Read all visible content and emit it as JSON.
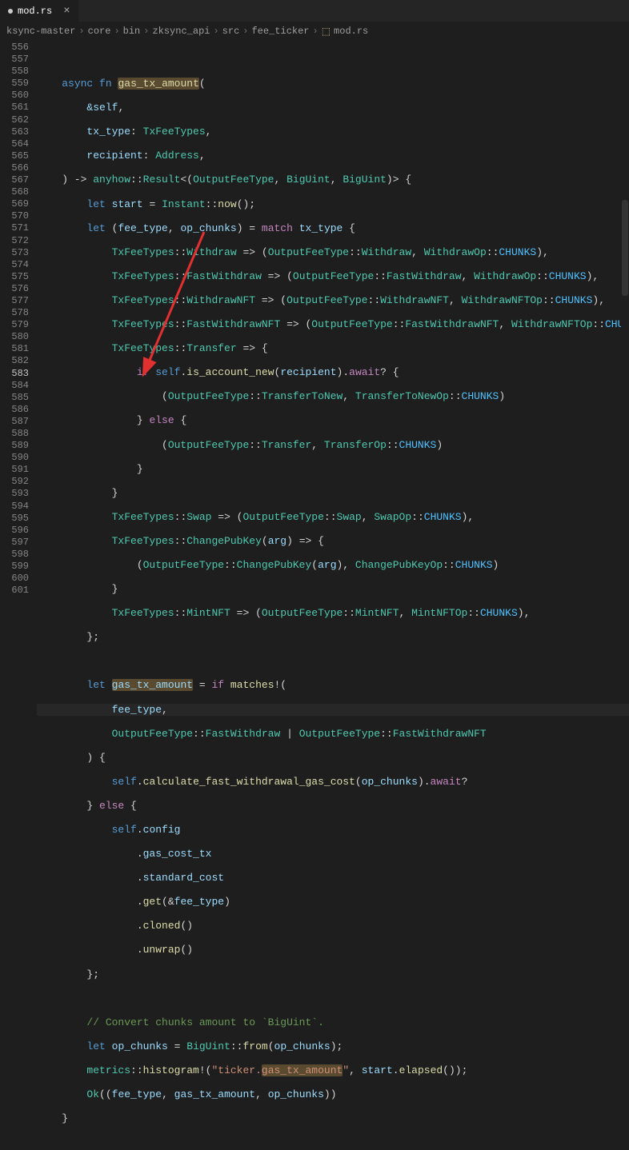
{
  "tab": {
    "filename": "mod.rs"
  },
  "breadcrumb": [
    "ksync-master",
    "core",
    "bin",
    "zksync_api",
    "src",
    "fee_ticker",
    "mod.rs"
  ],
  "line_start": 556,
  "line_end": 601,
  "highlighted_line": 583,
  "tokens": {
    "kw_async": "async",
    "kw_fn": "fn",
    "kw_let": "let",
    "kw_if": "if",
    "kw_else": "else",
    "kw_match": "match",
    "kw_self": "self",
    "t_TxFeeTypes": "TxFeeTypes",
    "t_Address": "Address",
    "t_Result": "Result",
    "t_OutputFeeType": "OutputFeeType",
    "t_BigUint": "BigUint",
    "t_Instant": "Instant",
    "t_WithdrawOp": "WithdrawOp",
    "t_WithdrawNFTOp": "WithdrawNFTOp",
    "t_TransferToNewOp": "TransferToNewOp",
    "t_TransferOp": "TransferOp",
    "t_SwapOp": "SwapOp",
    "t_ChangePubKeyOp": "ChangePubKeyOp",
    "t_MintNFTOp": "MintNFTOp",
    "fn_gas_tx_amount": "gas_tx_amount",
    "fn_now": "now",
    "fn_is_account_new": "is_account_new",
    "fn_await": "await",
    "fn_calculate": "calculate_fast_withdrawal_gas_cost",
    "fn_from": "from",
    "fn_histogram": "histogram",
    "fn_elapsed": "elapsed",
    "fn_get": "get",
    "fn_cloned": "cloned",
    "fn_unwrap": "unwrap",
    "fn_matches": "matches",
    "v_selfref": "&self",
    "v_tx_type": "tx_type",
    "v_recipient": "recipient",
    "v_start": "start",
    "v_fee_type": "fee_type",
    "v_op_chunks": "op_chunks",
    "v_arg": "arg",
    "v_gas_tx_amount": "gas_tx_amount",
    "v_config": "config",
    "v_gas_cost_tx": "gas_cost_tx",
    "v_standard_cost": "standard_cost",
    "c_CHUNKS": "CHUNKS",
    "e_Withdraw": "Withdraw",
    "e_FastWithdraw": "FastWithdraw",
    "e_WithdrawNFT": "WithdrawNFT",
    "e_FastWithdrawNFT": "FastWithdrawNFT",
    "e_Transfer": "Transfer",
    "e_TransferToNew": "TransferToNew",
    "e_Swap": "Swap",
    "e_ChangePubKey": "ChangePubKey",
    "e_MintNFT": "MintNFT",
    "m_anyhow": "anyhow",
    "m_metrics": "metrics",
    "s_ticker": "\"ticker.gas_tx_amount\"",
    "comment_convert": "// Convert chunks amount to `BigUint`.",
    "fn_Ok": "Ok"
  }
}
